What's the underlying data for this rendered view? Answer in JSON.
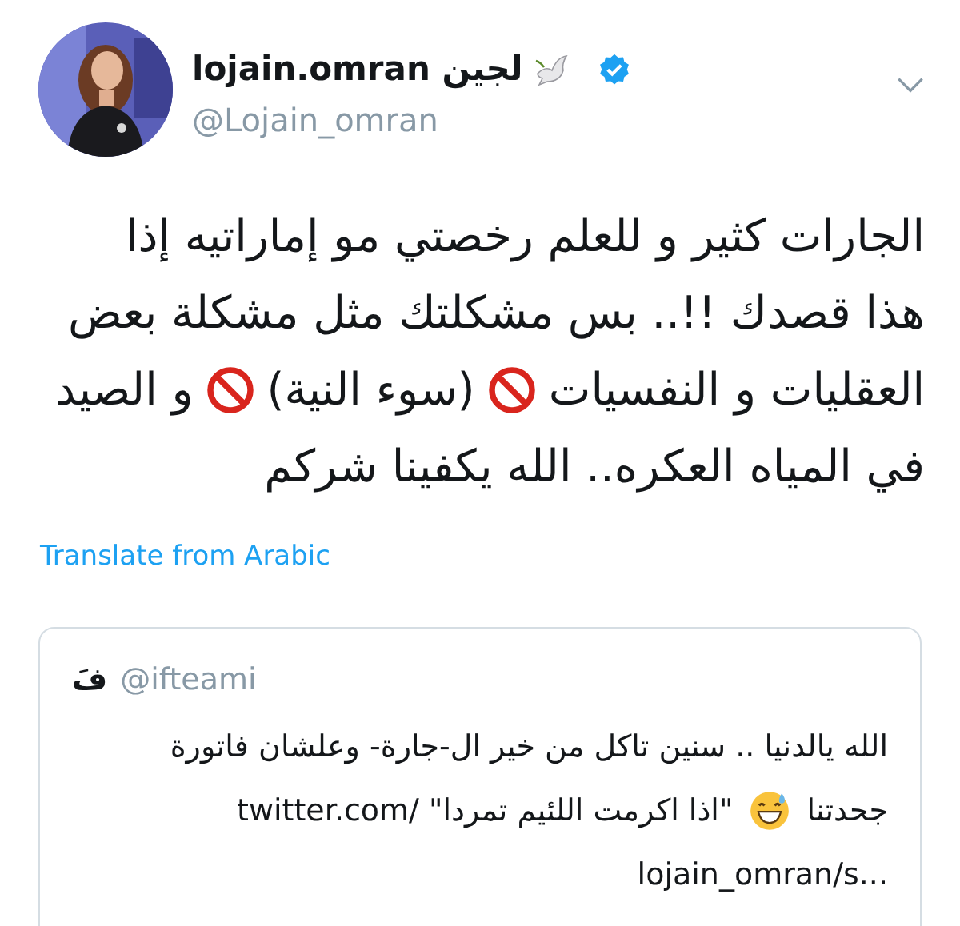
{
  "author": {
    "name": "lojain.omran لجين",
    "verified": true,
    "handle": "@Lojain_omran"
  },
  "body_lines": [
    [
      {
        "kind": "text",
        "text": "الجارات كثير و للعلم رخصتي مو إماراتيه إذا"
      }
    ],
    [
      {
        "kind": "text",
        "text": "هذا قصدك !!.. بس مشكلتك مثل مشكلة بعض"
      }
    ],
    [
      {
        "kind": "text",
        "text": "العقليات و النفسيات"
      },
      {
        "kind": "prohibited"
      },
      {
        "kind": "text",
        "text": "(سوء النية)"
      },
      {
        "kind": "prohibited"
      },
      {
        "kind": "text",
        "text": "و الصيد"
      }
    ],
    [
      {
        "kind": "text",
        "text": "في المياه العكره.. الله يكفينا شركم"
      }
    ]
  ],
  "translate_link": "Translate from Arabic",
  "quoted_tweet": {
    "name": "فَ",
    "handle": "@ifteami",
    "lines": [
      [
        {
          "kind": "text",
          "text": "الله يالدنيا .. سنين تاكل من خير ال-جارة- وعلشان فاتورة"
        }
      ],
      [
        {
          "kind": "text",
          "text": "جحدتنا"
        },
        {
          "kind": "sweat_smile"
        },
        {
          "kind": "text",
          "text": "\"اذا اكرمت اللئيم تمردا\""
        },
        {
          "kind": "link",
          "text": "twitter.com/"
        }
      ],
      [
        {
          "kind": "link",
          "text": "lojain_omran/s..."
        }
      ]
    ]
  }
}
